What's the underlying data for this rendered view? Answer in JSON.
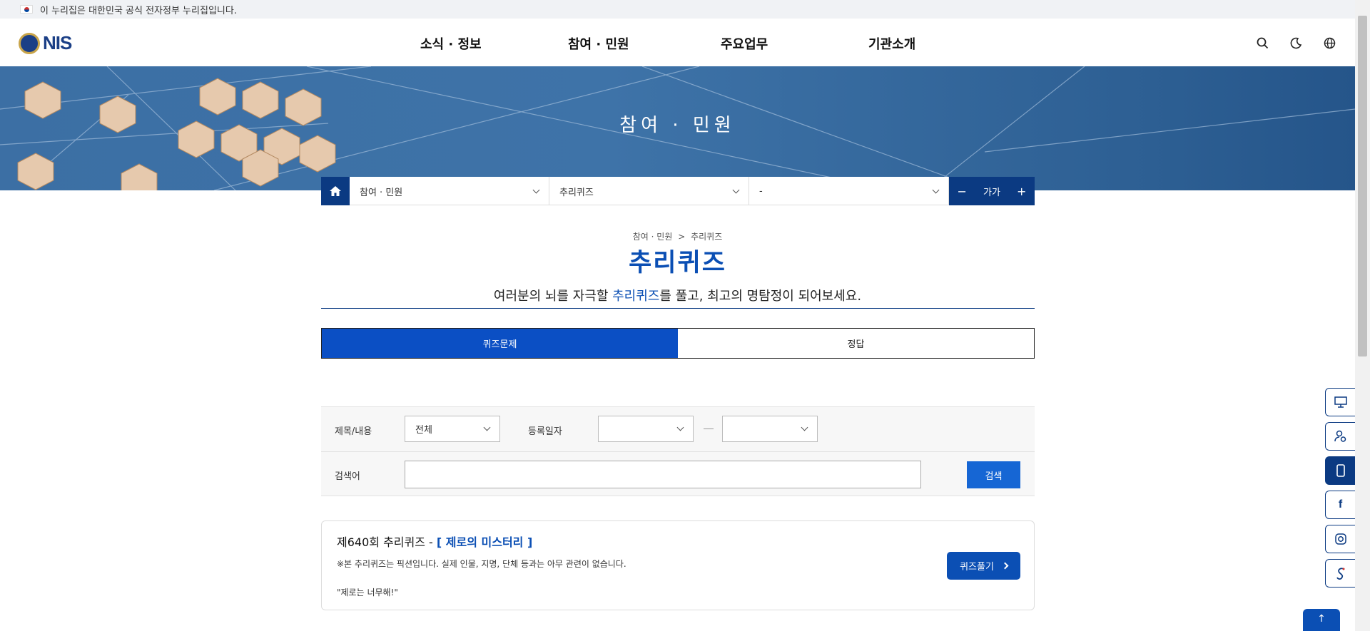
{
  "gov_notice": "이 누리집은 대한민국 공식 전자정부 누리집입니다.",
  "logo": {
    "text": "NIS"
  },
  "nav": [
    "소식 · 정보",
    "참여 · 민원",
    "주요업무",
    "기관소개"
  ],
  "header_icons": [
    "search-icon",
    "dark-mode-icon",
    "globe-icon"
  ],
  "banner": {
    "title": "참여 · 민원"
  },
  "location_bar": {
    "level1": "참여 · 민원",
    "level2": "추리퀴즈",
    "level3": "-",
    "font_minus": "−",
    "font_label": "가가",
    "font_plus": "+"
  },
  "breadcrumb": {
    "parent": "참여 · 민원",
    "separator": ">",
    "current": "추리퀴즈"
  },
  "page_title": "추리퀴즈",
  "subtitle": {
    "before": "여러분의 뇌를 자극할 ",
    "highlight": "추리퀴즈",
    "after": "를 풀고, 최고의 명탐정이 되어보세요."
  },
  "tabs": [
    {
      "label": "퀴즈문제",
      "active": true
    },
    {
      "label": "정답",
      "active": false
    }
  ],
  "search": {
    "field_label": "제목/내용",
    "field_value": "전체",
    "date_label": "등록일자",
    "date_from": "",
    "date_to": "",
    "keyword_label": "검색어",
    "keyword_value": "",
    "button": "검색"
  },
  "quiz_card": {
    "title_prefix": "제640회 추리퀴즈 - ",
    "title_highlight": "[ 제로의 미스터리 ]",
    "note": "※본 추리퀴즈는 픽션입니다. 실제 인물, 지명, 단체 등과는 아무 관련이 없습니다.",
    "quote": "\"제로는 너무해!\"",
    "button": "퀴즈풀기"
  },
  "quick_menu": [
    "monitor-icon",
    "person-search-icon",
    "mobile-icon",
    "facebook-icon",
    "instagram-icon",
    "youtube-icon"
  ],
  "top_button": "↑",
  "colors": {
    "primary": "#0b4fb4",
    "navy": "#0b3a82",
    "banner": "#3c6fa4"
  }
}
